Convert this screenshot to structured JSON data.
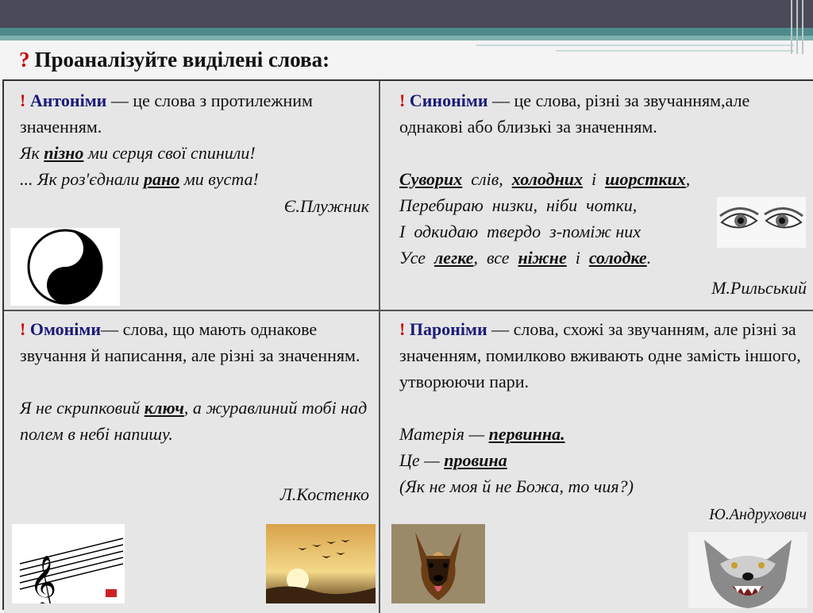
{
  "slide": {
    "title_mark": "?",
    "title": "Проаналізуйте виділені слова:"
  },
  "cells": {
    "antonyms": {
      "mark": "!",
      "term": "Антоніми",
      "def": " — це слова з протилежним значенням.",
      "q1a": "Як ",
      "q1kw": "пізно",
      "q1b": " ми серця свої спинили!",
      "q2a": "... Як роз'єднали ",
      "q2kw": "рано",
      "q2b": " ми вуста!",
      "author": "Є.Плужник",
      "icon": "yin-yang-icon"
    },
    "synonyms": {
      "mark": "!",
      "term": "Синоніми",
      "def": " — це слова, різні за звучанням,але однакові або близькі за значенням.",
      "l1kw1": "Суворих",
      "l1a": "  слів,  ",
      "l1kw2": "холодних",
      "l1b": "  і  ",
      "l1kw3": "шорстких",
      "l1c": ",",
      "l2": "Перебираю  низки,  ніби  чотки,",
      "l3": "І  одкидаю  твердо  з-поміж них",
      "l4a": "Усе  ",
      "l4kw1": "легке",
      "l4b": ",  все  ",
      "l4kw2": "ніжне",
      "l4c": "  і  ",
      "l4kw3": "солодке",
      "l4d": ".",
      "author": "М.Рильський",
      "icon": "eyes-icon"
    },
    "homonyms": {
      "mark": "!",
      "term": "Омоніми",
      "def": "— слова, що мають однакове звучання й написання, але різні за значенням.",
      "qa": "Я не скрипковий ",
      "qkw": "ключ",
      "qb": ", а журавлиний тобі над полем в небі напишу.",
      "author": "Л.Костенко",
      "icon1": "treble-clef-icon",
      "icon2": "cranes-sunset-icon"
    },
    "paronyms": {
      "mark": "!",
      "term": "Пароніми",
      "def": " — слова, схожі за звучанням, але різні за значенням, помилково вживають одне замість іншого, утворюючи  пари.",
      "l1a": "Матерія — ",
      "l1kw": "первинна.",
      "l2a": "Це — ",
      "l2kw": "провина",
      "l3": "(Як не моя й не Божа, то чия?)",
      "author": "Ю.Андрухович",
      "icon1": "dog-icon",
      "icon2": "wolf-icon"
    }
  }
}
